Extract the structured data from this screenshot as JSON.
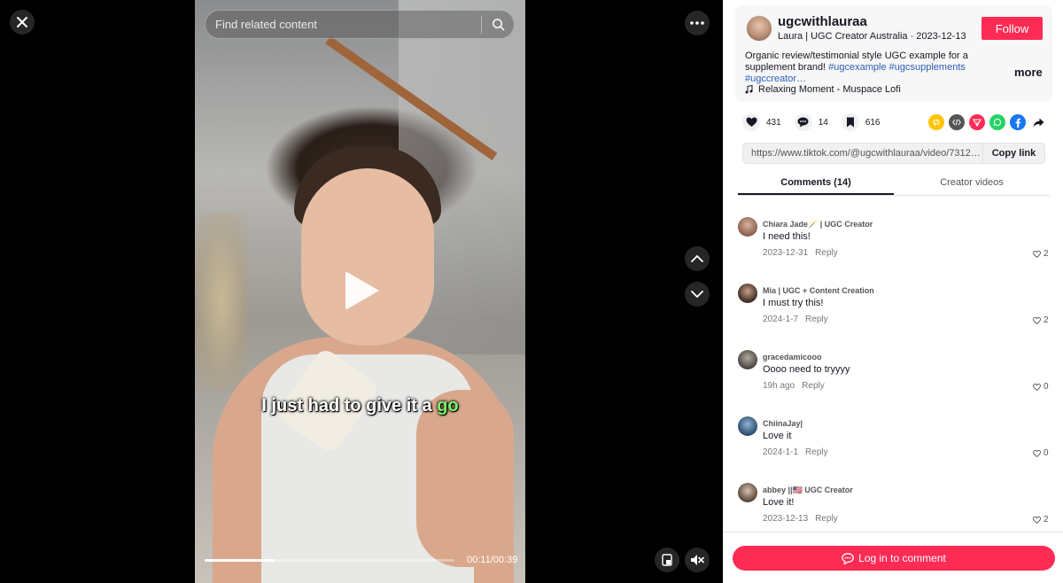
{
  "video": {
    "search_placeholder": "Find related content",
    "caption_main": "I just had to give it a ",
    "caption_highlight": "go",
    "time": "00:11/00:39",
    "progress_fraction": 0.28
  },
  "author": {
    "username": "ugcwithlauraa",
    "subline": "Laura | UGC Creator Australia · 2023-12-13",
    "follow_label": "Follow",
    "description": "Organic review/testimonial style UGC example for a supplement brand! ",
    "hashtags": "#ugcexample #ugcsupplements #ugccreator…",
    "more_label": "more",
    "music": "Relaxing Moment - Muspace Lofi"
  },
  "stats": {
    "likes": "431",
    "comments": "14",
    "saves": "616"
  },
  "link": {
    "url": "https://www.tiktok.com/@ugcwithlauraa/video/7312211...",
    "copy_label": "Copy link"
  },
  "tabs": {
    "comments": "Comments (14)",
    "creator_videos": "Creator videos"
  },
  "comments": [
    {
      "user": "Chiara Jade🪄 | UGC Creator",
      "text": "I need this!",
      "date": "2023-12-31",
      "reply": "Reply",
      "likes": "2"
    },
    {
      "user": "Mia | UGC + Content Creation",
      "text": "I must try this!",
      "date": "2024-1-7",
      "reply": "Reply",
      "likes": "2"
    },
    {
      "user": "gracedamicooo",
      "text": "Oooo need to tryyyy",
      "date": "19h ago",
      "reply": "Reply",
      "likes": "0"
    },
    {
      "user": "ChiinaJay|",
      "text": "Love it",
      "date": "2024-1-1",
      "reply": "Reply",
      "likes": "0"
    },
    {
      "user": "abbey ||🇺🇸 UGC Creator",
      "text": "Love it!",
      "date": "2023-12-13",
      "reply": "Reply",
      "likes": "2"
    }
  ],
  "bottom": {
    "login_label": "Log in to comment"
  },
  "colors": {
    "brand": "#fe2c55",
    "hashtag": "#2b5db9",
    "caption_highlight": "#7cf26a"
  }
}
